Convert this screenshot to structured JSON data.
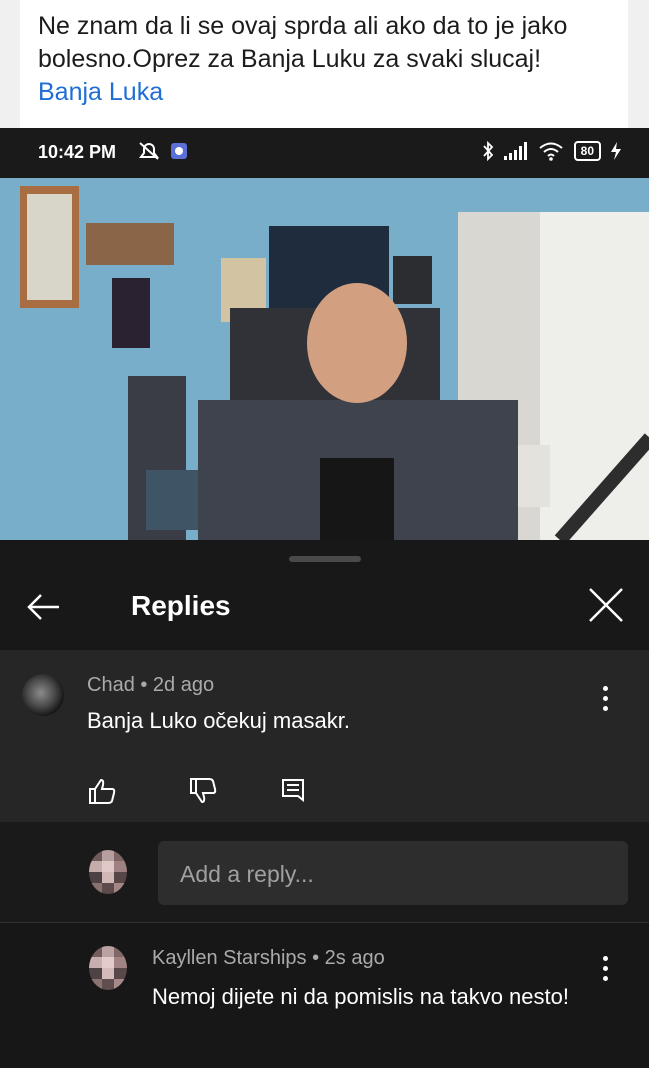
{
  "post_caption": {
    "text": "Ne znam da li se ovaj sprda ali ako da to je jako bolesno.Oprez za Banja Luku za svaki slucaj!",
    "link": "Banja Luka"
  },
  "status_bar": {
    "time": "10:42 PM",
    "battery": "80",
    "left_icons": [
      "mute-icon",
      "app-notification-icon"
    ],
    "right_icons": [
      "bluetooth-icon",
      "signal-icon",
      "wifi-icon",
      "battery-icon",
      "charging-icon"
    ]
  },
  "video": {
    "watermark_icon": "instagram-icon"
  },
  "replies_panel": {
    "title": "Replies",
    "back_icon": "back-arrow-icon",
    "close_icon": "close-icon"
  },
  "comment": {
    "author": "Chad",
    "age": "2d ago",
    "meta": "Chad • 2d ago",
    "text": "Banja Luko očekuj masakr.",
    "actions": [
      "like-icon",
      "dislike-icon",
      "reply-icon"
    ]
  },
  "reply_input": {
    "placeholder": "Add a reply..."
  },
  "reply": {
    "author": "Kayllen Starships",
    "age": "2s ago",
    "meta": "Kayllen Starships • 2s ago",
    "text": "Nemoj dijete ni da pomislis na takvo nesto!"
  },
  "colors": {
    "link_blue": "#1f6ed4",
    "sheet_background": "#181818",
    "comment_background": "#262626",
    "text_secondary": "#aaaaaa"
  }
}
